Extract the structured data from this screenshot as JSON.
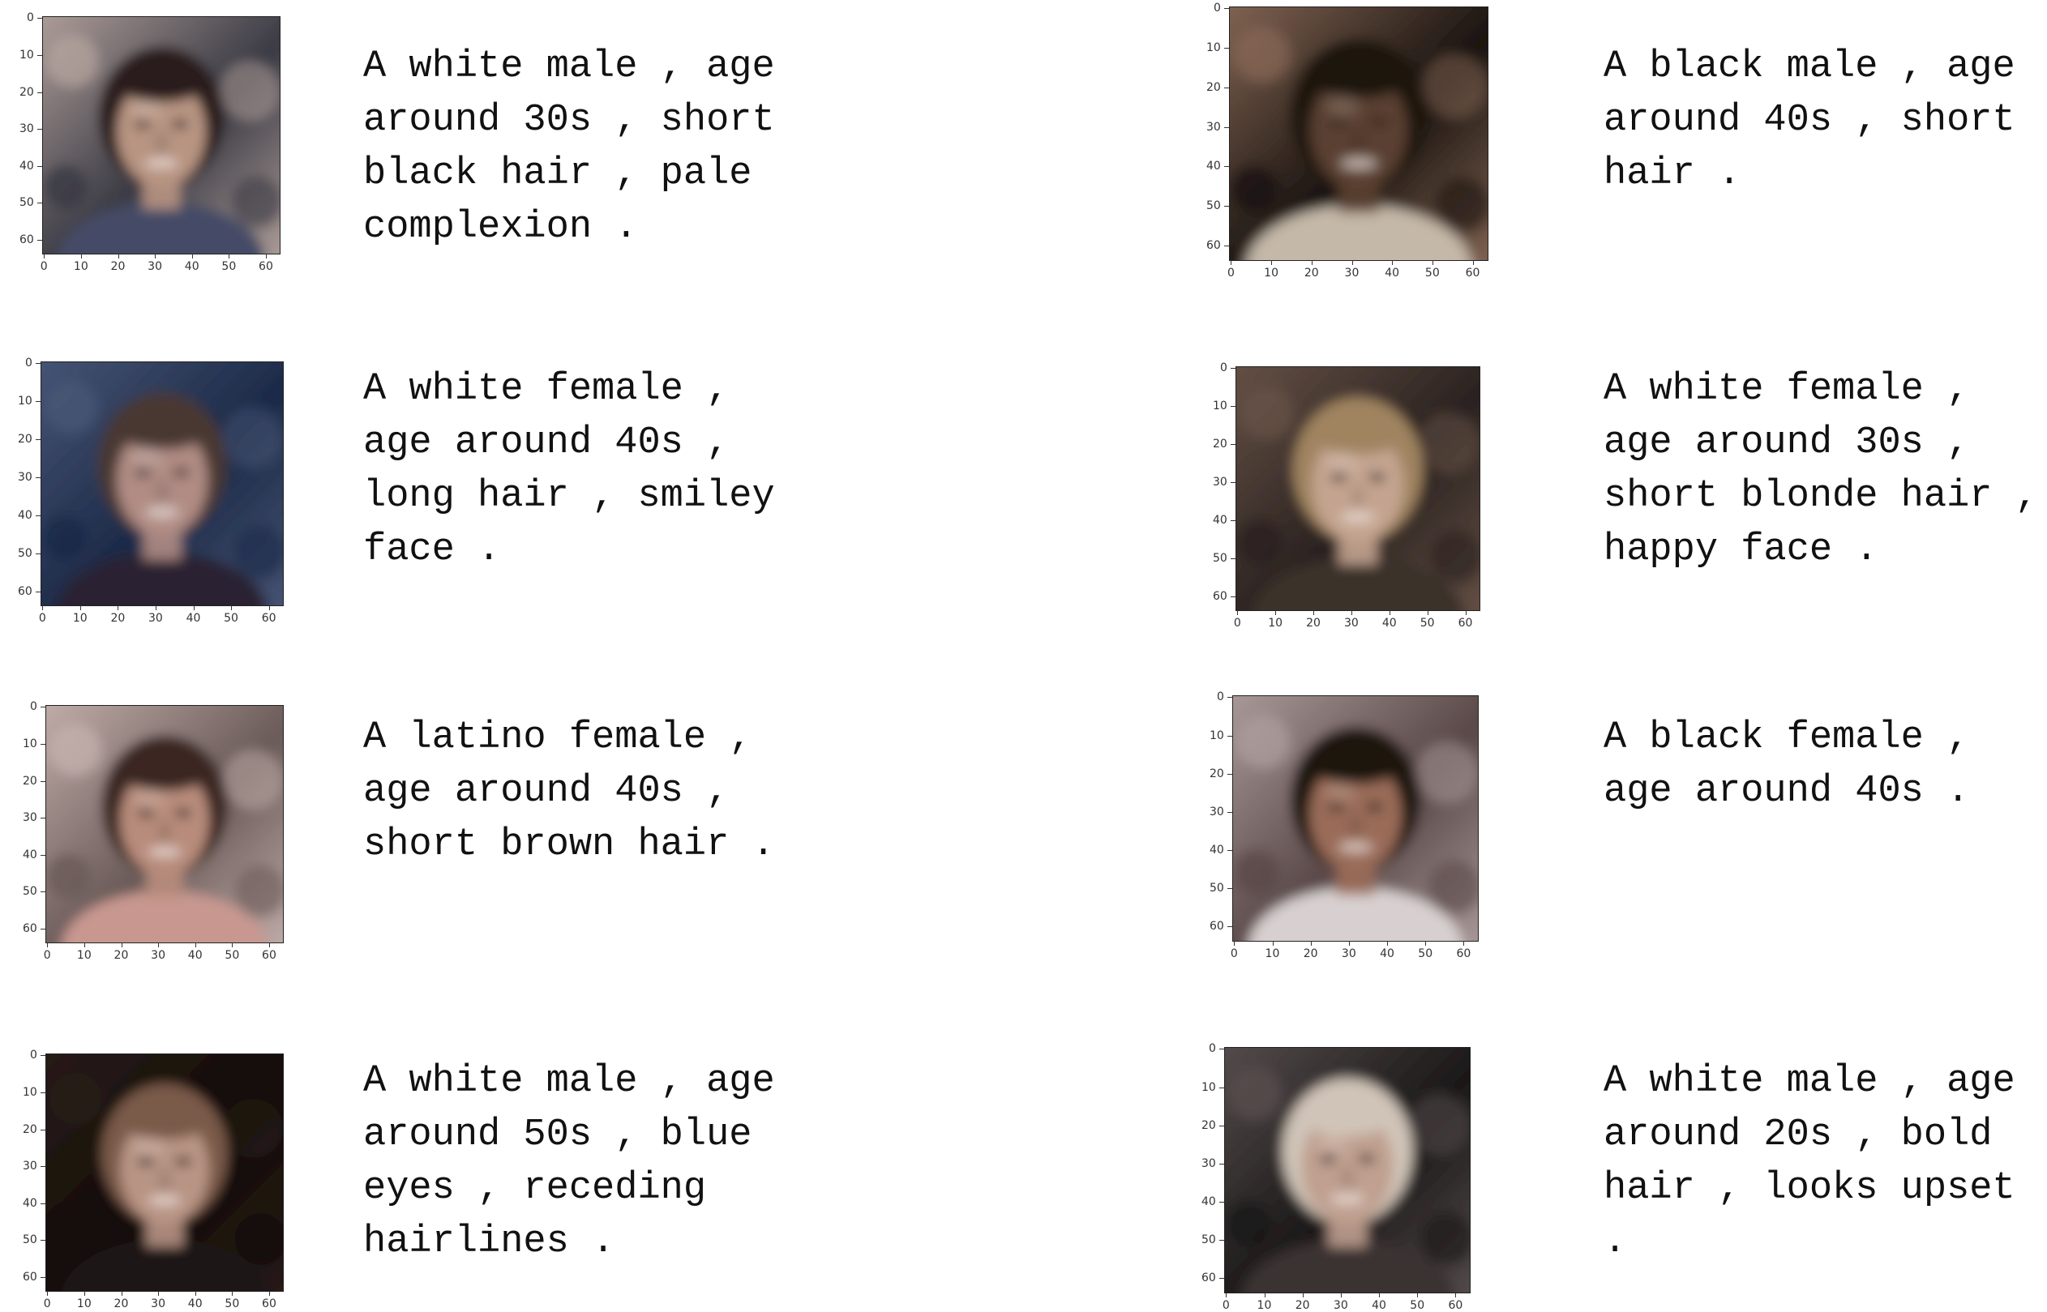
{
  "axis_ticks": [
    "0",
    "10",
    "20",
    "30",
    "40",
    "50",
    "60"
  ],
  "panels": [
    {
      "lines": [
        "A white male , age",
        "around 30s , short",
        "black hair , pale",
        "complexion ."
      ],
      "palette": {
        "bg1": "#3a3a44",
        "bg2": "#b8a6a0",
        "skin": "#b89482",
        "hair": "#2a1f1a",
        "cloth": "#444b66"
      }
    },
    {
      "lines": [
        "A black male , age",
        "around 40s , short",
        "hair ."
      ],
      "palette": {
        "bg1": "#1a1410",
        "bg2": "#8a6a58",
        "skin": "#5a4030",
        "hair": "#1a120e",
        "cloth": "#c4b8a8"
      }
    },
    {
      "lines": [
        "A white female ,",
        "age around 40s ,",
        "long hair , smiley",
        "face ."
      ],
      "palette": {
        "bg1": "#1c2a48",
        "bg2": "#4a5878",
        "skin": "#b08c84",
        "hair": "#4a3830",
        "cloth": "#2a2430"
      }
    },
    {
      "lines": [
        "A white female ,",
        "age around 30s ,",
        "short blonde hair ,",
        "happy face ."
      ],
      "palette": {
        "bg1": "#2a2220",
        "bg2": "#6a5448",
        "skin": "#c4a490",
        "hair": "#a08460",
        "cloth": "#3a302c"
      }
    },
    {
      "lines": [
        "A latino female ,",
        "age around 40s ,",
        "short brown hair ."
      ],
      "palette": {
        "bg1": "#6a5a58",
        "bg2": "#c8b4b0",
        "skin": "#b88c7c",
        "hair": "#3a2820",
        "cloth": "#c89890"
      }
    },
    {
      "lines": [
        "A black female ,",
        "age around 40s ."
      ],
      "palette": {
        "bg1": "#5a4848",
        "bg2": "#b0a0a0",
        "skin": "#9a6c58",
        "hair": "#1e1410",
        "cloth": "#d8d0d0"
      }
    },
    {
      "lines": [
        "A white male , age",
        "around 50s , blue",
        "eyes , receding",
        "hairlines ."
      ],
      "palette": {
        "bg1": "#120c0a",
        "bg2": "#2a1c18",
        "skin": "#b89484",
        "hair": "#7a5a48",
        "cloth": "#1a1416"
      }
    },
    {
      "lines": [
        "A white male , age",
        "around 20s , bold",
        "hair , looks upset",
        "."
      ],
      "palette": {
        "bg1": "#1a1818",
        "bg2": "#5a5050",
        "skin": "#c0a090",
        "hair": "#d0c4b8",
        "cloth": "#3a3030"
      }
    }
  ]
}
